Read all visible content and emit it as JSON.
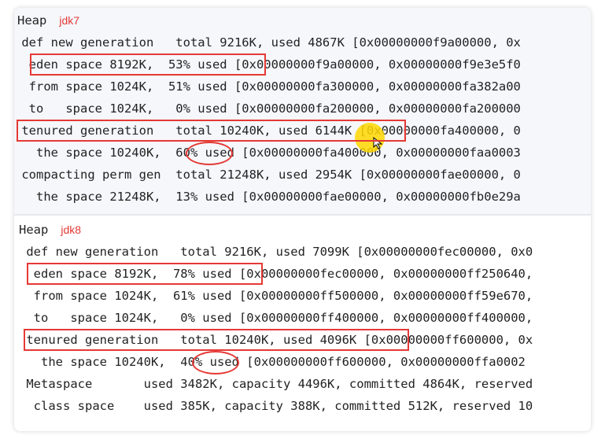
{
  "jdk7": {
    "heap_label": "Heap",
    "version_tag": "jdk7",
    "lines": [
      " def new generation   total 9216K, used 4867K [0x00000000f9a00000, 0x",
      "  eden space 8192K,  53% used [0x00000000f9a00000, 0x00000000f9e3e5f0",
      "  from space 1024K,  51% used [0x00000000fa300000, 0x00000000fa382a00",
      "  to   space 1024K,   0% used [0x00000000fa200000, 0x00000000fa200000",
      " tenured generation   total 10240K, used 6144K [0x00000000fa400000, 0",
      "   the space 10240K,  60% used [0x00000000fa400000, 0x00000000faa0003",
      " compacting perm gen  total 21248K, used 2954K [0x00000000fae00000, 0",
      "   the space 21248K,  13% used [0x00000000fae00000, 0x00000000fb0e29a"
    ]
  },
  "jdk8": {
    "heap_label": "Heap",
    "version_tag": "jdk8",
    "lines": [
      " def new generation   total 9216K, used 7099K [0x00000000fec00000, 0x0",
      "  eden space 8192K,  78% used [0x00000000fec00000, 0x00000000ff250640,",
      "  from space 1024K,  61% used [0x00000000ff500000, 0x00000000ff59e670,",
      "  to   space 1024K,   0% used [0x00000000ff400000, 0x00000000ff400000,",
      " tenured generation   total 10240K, used 4096K [0x00000000ff600000, 0x",
      "   the space 10240K,  40% used [0x00000000ff600000, 0x00000000ffa0002",
      " Metaspace       used 3482K, capacity 4496K, committed 4864K, reserved",
      "  class space    used 385K, capacity 388K, committed 512K, reserved 10"
    ]
  },
  "colors": {
    "annotation": "#e53935",
    "cursor_highlight": "#ffd700",
    "text": "#222222"
  }
}
